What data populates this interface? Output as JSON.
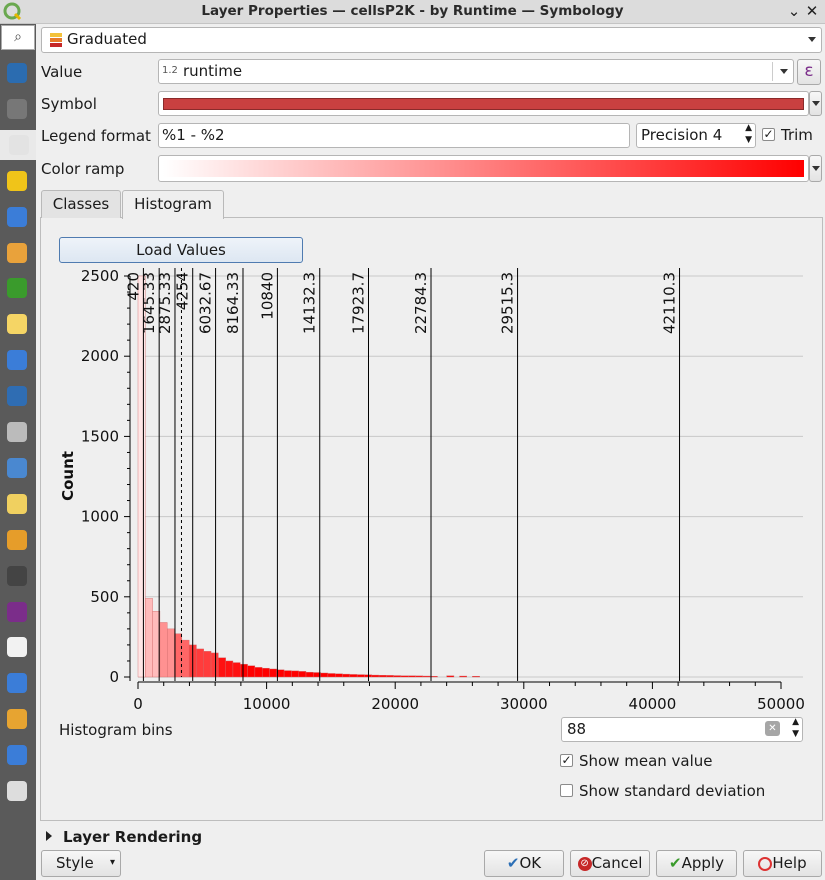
{
  "window": {
    "title": "Layer Properties — cellsP2K - by Runtime — Symbology"
  },
  "sidebar": {
    "items": [
      {
        "icon": "info-icon"
      },
      {
        "icon": "source-icon"
      },
      {
        "icon": "symbology-icon"
      },
      {
        "icon": "labels-icon"
      },
      {
        "icon": "mask-icon"
      },
      {
        "icon": "3d-view-icon"
      },
      {
        "icon": "diagrams-icon"
      },
      {
        "icon": "fields-icon"
      },
      {
        "icon": "attributes-form-icon"
      },
      {
        "icon": "joins-icon"
      },
      {
        "icon": "auxiliary-storage-icon"
      },
      {
        "icon": "actions-icon"
      },
      {
        "icon": "display-icon"
      },
      {
        "icon": "rendering-icon"
      },
      {
        "icon": "temporal-icon"
      },
      {
        "icon": "variables-icon"
      },
      {
        "icon": "metadata-icon"
      },
      {
        "icon": "dependencies-icon"
      },
      {
        "icon": "legend-icon"
      },
      {
        "icon": "qgis-server-icon"
      },
      {
        "icon": "digitizing-icon"
      }
    ]
  },
  "renderer": {
    "type": "Graduated"
  },
  "form": {
    "value_label": "Value",
    "value_type": "1.2",
    "value_field": "runtime",
    "epsilon": "ε",
    "symbol_label": "Symbol",
    "symbol_color": "#c94040",
    "legend_format_label": "Legend format",
    "legend_format": "%1 - %2",
    "precision_text": "Precision 4",
    "trim_label": "Trim",
    "trim_checked": true,
    "color_ramp_label": "Color ramp",
    "ramp_from": "#ffffff",
    "ramp_to": "#ff0000"
  },
  "tabs": [
    {
      "label": "Classes",
      "active": false
    },
    {
      "label": "Histogram",
      "active": true
    }
  ],
  "histogram": {
    "load_values_label": "Load Values",
    "bins_label": "Histogram bins",
    "bins_value": "88",
    "show_mean_label": "Show mean value",
    "show_mean_checked": true,
    "show_std_label": "Show standard deviation",
    "show_std_checked": false
  },
  "chart_data": {
    "type": "bar",
    "title": "",
    "xlabel": "",
    "ylabel": "Count",
    "xlim": [
      0,
      50000
    ],
    "ylim": [
      0,
      2500
    ],
    "xticks": [
      0,
      10000,
      20000,
      30000,
      40000,
      50000
    ],
    "yticks": [
      0,
      500,
      1000,
      1500,
      2000,
      2500
    ],
    "bin_width": 568,
    "bins": [
      {
        "x0": 0,
        "count": 2500
      },
      {
        "x0": 568,
        "count": 490
      },
      {
        "x0": 1136,
        "count": 410
      },
      {
        "x0": 1704,
        "count": 340
      },
      {
        "x0": 2272,
        "count": 300
      },
      {
        "x0": 2840,
        "count": 270
      },
      {
        "x0": 3408,
        "count": 230
      },
      {
        "x0": 3976,
        "count": 200
      },
      {
        "x0": 4544,
        "count": 175
      },
      {
        "x0": 5112,
        "count": 160
      },
      {
        "x0": 5680,
        "count": 150
      },
      {
        "x0": 6248,
        "count": 120
      },
      {
        "x0": 6816,
        "count": 100
      },
      {
        "x0": 7384,
        "count": 90
      },
      {
        "x0": 7952,
        "count": 80
      },
      {
        "x0": 8520,
        "count": 70
      },
      {
        "x0": 9088,
        "count": 60
      },
      {
        "x0": 9656,
        "count": 55
      },
      {
        "x0": 10224,
        "count": 50
      },
      {
        "x0": 10792,
        "count": 45
      },
      {
        "x0": 11360,
        "count": 40
      },
      {
        "x0": 11928,
        "count": 38
      },
      {
        "x0": 12496,
        "count": 35
      },
      {
        "x0": 13064,
        "count": 30
      },
      {
        "x0": 13632,
        "count": 28
      },
      {
        "x0": 14200,
        "count": 25
      },
      {
        "x0": 14768,
        "count": 22
      },
      {
        "x0": 15336,
        "count": 20
      },
      {
        "x0": 15904,
        "count": 18
      },
      {
        "x0": 16472,
        "count": 16
      },
      {
        "x0": 17040,
        "count": 15
      },
      {
        "x0": 17608,
        "count": 14
      },
      {
        "x0": 18176,
        "count": 12
      },
      {
        "x0": 18744,
        "count": 11
      },
      {
        "x0": 19312,
        "count": 10
      },
      {
        "x0": 19880,
        "count": 9
      },
      {
        "x0": 20448,
        "count": 8
      },
      {
        "x0": 21016,
        "count": 8
      },
      {
        "x0": 21584,
        "count": 7
      },
      {
        "x0": 22152,
        "count": 6
      },
      {
        "x0": 22720,
        "count": 5
      },
      {
        "x0": 24000,
        "count": 8
      },
      {
        "x0": 25000,
        "count": 6
      },
      {
        "x0": 26000,
        "count": 5
      }
    ],
    "class_breaks": [
      {
        "value": 420,
        "label": "420"
      },
      {
        "value": 1645.33,
        "label": "1645.33"
      },
      {
        "value": 2875.33,
        "label": "2875.33"
      },
      {
        "value": 4254,
        "label": "4254"
      },
      {
        "value": 6032.67,
        "label": "6032.67"
      },
      {
        "value": 8164.33,
        "label": "8164.33"
      },
      {
        "value": 10840,
        "label": "10840"
      },
      {
        "value": 14132.3,
        "label": "14132.3"
      },
      {
        "value": 17923.7,
        "label": "17923.7"
      },
      {
        "value": 22784.3,
        "label": "22784.3"
      },
      {
        "value": 29515.3,
        "label": "29515.3"
      },
      {
        "value": 42110.3,
        "label": "42110.3"
      }
    ],
    "mean": 3380,
    "ramp_from": "#ffffff",
    "ramp_to": "#ff0000",
    "grid": true
  },
  "rendering_section": {
    "label": "Layer Rendering"
  },
  "footer": {
    "style_label": "Style",
    "ok_label": "OK",
    "cancel_label": "Cancel",
    "apply_label": "Apply",
    "help_label": "Help"
  }
}
